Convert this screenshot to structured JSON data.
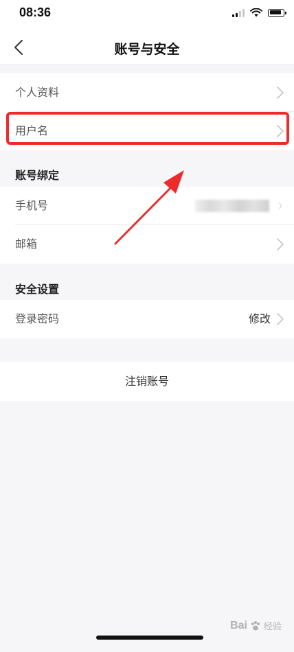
{
  "status_bar": {
    "time": "08:36",
    "signal_bars": 4,
    "signal_active": 2,
    "battery_level": 0.85,
    "icons": [
      "signal-icon",
      "wifi-icon",
      "battery-icon"
    ]
  },
  "nav": {
    "title": "账号与安全",
    "back_icon": "chevron-left-icon"
  },
  "groups": {
    "profile": {
      "items": [
        {
          "label": "个人资料"
        },
        {
          "label": "用户名"
        }
      ]
    },
    "binding": {
      "header": "账号绑定",
      "items": [
        {
          "label": "手机号"
        },
        {
          "label": "邮箱"
        }
      ]
    },
    "security": {
      "header": "安全设置",
      "items": [
        {
          "label": "登录密码",
          "value": "修改"
        }
      ]
    }
  },
  "deregister": {
    "label": "注销账号"
  },
  "annotation": {
    "highlight_color": "#ee2b2b"
  },
  "watermark": {
    "brand": "Bai",
    "text": "经验"
  }
}
